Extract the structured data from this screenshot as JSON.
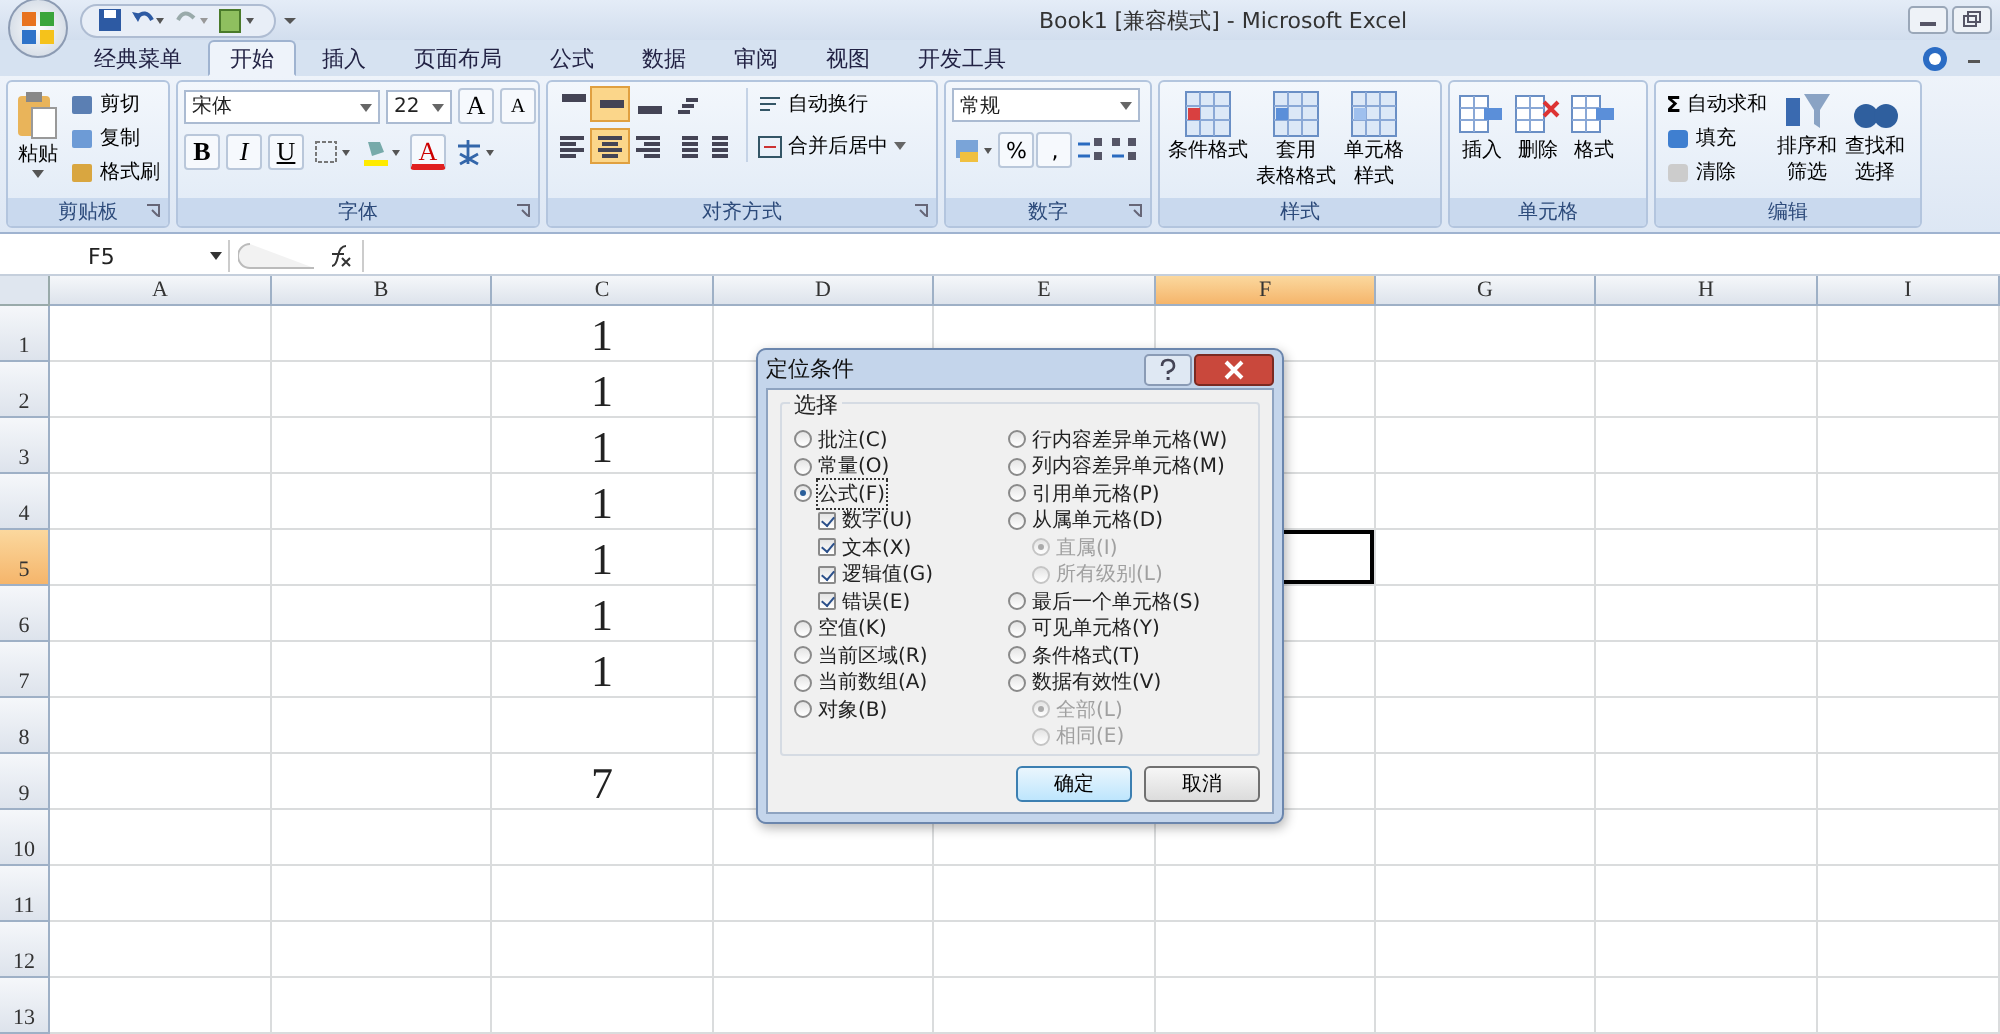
{
  "window": {
    "title": "Book1  [兼容模式] - Microsoft Excel"
  },
  "tabs": [
    {
      "label": "经典菜单",
      "selected": false
    },
    {
      "label": "开始",
      "selected": true
    },
    {
      "label": "插入",
      "selected": false
    },
    {
      "label": "页面布局",
      "selected": false
    },
    {
      "label": "公式",
      "selected": false
    },
    {
      "label": "数据",
      "selected": false
    },
    {
      "label": "审阅",
      "selected": false
    },
    {
      "label": "视图",
      "selected": false
    },
    {
      "label": "开发工具",
      "selected": false
    }
  ],
  "ribbon": {
    "clipboard": {
      "title": "剪贴板",
      "paste": "粘贴",
      "items": [
        "剪切",
        "复制",
        "格式刷"
      ]
    },
    "font": {
      "title": "字体",
      "font_name": "宋体",
      "font_size": "22",
      "grow": "A",
      "shrink": "A",
      "bold": "B",
      "italic": "I",
      "underline": "U",
      "font_color": "A"
    },
    "alignment": {
      "title": "对齐方式",
      "rows": [
        [
          {
            "kind": "top",
            "selected": false
          },
          {
            "kind": "middle",
            "selected": true
          },
          {
            "kind": "bottom",
            "selected": false
          },
          {
            "kind": "orientation",
            "selected": false
          }
        ],
        [
          {
            "kind": "left",
            "selected": false
          },
          {
            "kind": "center",
            "selected": true
          },
          {
            "kind": "right",
            "selected": false
          },
          {
            "kind": "outdent",
            "selected": false
          },
          {
            "kind": "indent",
            "selected": false
          }
        ]
      ],
      "wrap": "自动换行",
      "merge": "合并后居中"
    },
    "number": {
      "title": "数字",
      "format": "常规",
      "percent": "%",
      "comma": ","
    },
    "styles": {
      "title": "样式",
      "buttons": [
        {
          "lines": [
            "条件格式"
          ]
        },
        {
          "lines": [
            "套用",
            "表格格式"
          ]
        },
        {
          "lines": [
            "单元格",
            "样式"
          ]
        }
      ]
    },
    "cells": {
      "title": "单元格",
      "buttons": [
        "插入",
        "删除",
        "格式"
      ]
    },
    "editing": {
      "title": "编辑",
      "sigma": "Σ",
      "items": [
        "自动求和",
        "填充",
        "清除"
      ],
      "buttons": [
        {
          "lines": [
            "排序和",
            "筛选"
          ]
        },
        {
          "lines": [
            "查找和",
            "选择"
          ]
        }
      ]
    }
  },
  "name_box": "F5",
  "columns": [
    {
      "label": "A",
      "selected": false
    },
    {
      "label": "B",
      "selected": false
    },
    {
      "label": "C",
      "selected": false
    },
    {
      "label": "D",
      "selected": false
    },
    {
      "label": "E",
      "selected": false
    },
    {
      "label": "F",
      "selected": true
    },
    {
      "label": "G",
      "selected": false
    },
    {
      "label": "H",
      "selected": false
    },
    {
      "label": "I",
      "selected": false
    }
  ],
  "rows": [
    {
      "label": "1",
      "selected": false,
      "C": "1"
    },
    {
      "label": "2",
      "selected": false,
      "C": "1"
    },
    {
      "label": "3",
      "selected": false,
      "C": "1"
    },
    {
      "label": "4",
      "selected": false,
      "C": "1"
    },
    {
      "label": "5",
      "selected": true,
      "C": "1"
    },
    {
      "label": "6",
      "selected": false,
      "C": "1"
    },
    {
      "label": "7",
      "selected": false,
      "C": "1"
    },
    {
      "label": "8",
      "selected": false
    },
    {
      "label": "9",
      "selected": false,
      "C": "7"
    },
    {
      "label": "10",
      "selected": false
    },
    {
      "label": "11",
      "selected": false
    },
    {
      "label": "12",
      "selected": false
    },
    {
      "label": "13",
      "selected": false
    }
  ],
  "dialog": {
    "title": "定位条件",
    "group": "选择",
    "left_options": [
      {
        "kind": "radio",
        "label": "批注(C)",
        "selected": false,
        "disabled": false
      },
      {
        "kind": "radio",
        "label": "常量(O)",
        "selected": false,
        "disabled": false
      },
      {
        "kind": "radio",
        "label": "公式(F)",
        "selected": true,
        "disabled": false,
        "children": [
          {
            "kind": "checkbox",
            "label": "数字(U)",
            "checked": true,
            "disabled": false
          },
          {
            "kind": "checkbox",
            "label": "文本(X)",
            "checked": true,
            "disabled": false
          },
          {
            "kind": "checkbox",
            "label": "逻辑值(G)",
            "checked": true,
            "disabled": false
          },
          {
            "kind": "checkbox",
            "label": "错误(E)",
            "checked": true,
            "disabled": false
          }
        ]
      },
      {
        "kind": "radio",
        "label": "空值(K)",
        "selected": false,
        "disabled": false
      },
      {
        "kind": "radio",
        "label": "当前区域(R)",
        "selected": false,
        "disabled": false
      },
      {
        "kind": "radio",
        "label": "当前数组(A)",
        "selected": false,
        "disabled": false
      },
      {
        "kind": "radio",
        "label": "对象(B)",
        "selected": false,
        "disabled": false
      }
    ],
    "right_options": [
      {
        "kind": "radio",
        "label": "行内容差异单元格(W)",
        "selected": false,
        "disabled": false
      },
      {
        "kind": "radio",
        "label": "列内容差异单元格(M)",
        "selected": false,
        "disabled": false
      },
      {
        "kind": "radio",
        "label": "引用单元格(P)",
        "selected": false,
        "disabled": false
      },
      {
        "kind": "radio",
        "label": "从属单元格(D)",
        "selected": false,
        "disabled": false,
        "children": [
          {
            "kind": "radio",
            "label": "直属(I)",
            "selected": true,
            "disabled": true
          },
          {
            "kind": "radio",
            "label": "所有级别(L)",
            "selected": false,
            "disabled": true
          }
        ]
      },
      {
        "kind": "radio",
        "label": "最后一个单元格(S)",
        "selected": false,
        "disabled": false
      },
      {
        "kind": "radio",
        "label": "可见单元格(Y)",
        "selected": false,
        "disabled": false
      },
      {
        "kind": "radio",
        "label": "条件格式(T)",
        "selected": false,
        "disabled": false
      },
      {
        "kind": "radio",
        "label": "数据有效性(V)",
        "selected": false,
        "disabled": false,
        "children": [
          {
            "kind": "radio",
            "label": "全部(L)",
            "selected": true,
            "disabled": true
          },
          {
            "kind": "radio",
            "label": "相同(E)",
            "selected": false,
            "disabled": true
          }
        ]
      }
    ],
    "buttons": [
      {
        "label": "确定",
        "default": true
      },
      {
        "label": "取消",
        "default": false
      }
    ]
  }
}
